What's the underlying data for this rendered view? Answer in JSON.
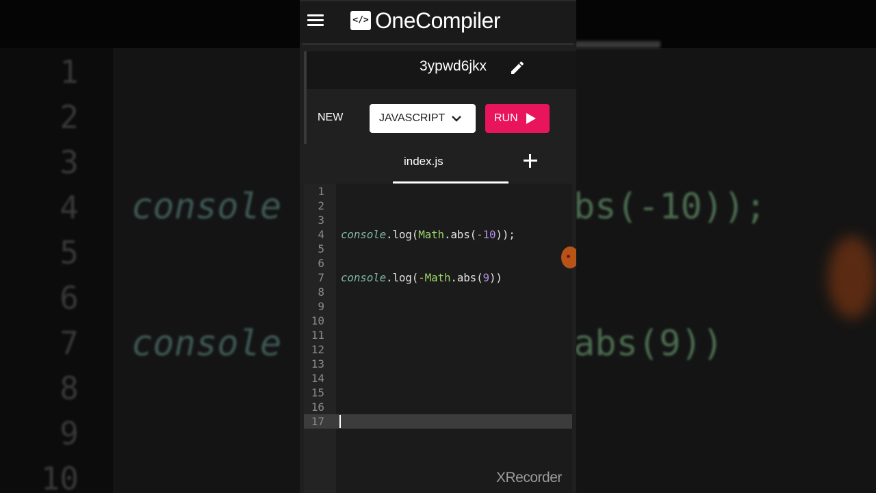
{
  "app": {
    "logo_mark": "</>",
    "name": "OneCompiler",
    "project_name": "3ypwd6jkx"
  },
  "toolbar": {
    "new_label": "NEW",
    "language": "JAVASCRIPT",
    "run_label": "RUN",
    "accent_color": "#e8155d"
  },
  "tabs": {
    "active_file": "index.js"
  },
  "editor": {
    "line_numbers": [
      "1",
      "2",
      "3",
      "4",
      "5",
      "6",
      "7",
      "8",
      "9",
      "10",
      "11",
      "12",
      "13",
      "14",
      "15",
      "16",
      "17"
    ],
    "active_line": "17",
    "lines": [
      {
        "number": 4,
        "tokens": [
          {
            "text": "console",
            "kind": "obj"
          },
          {
            "text": ".log(",
            "kind": "plain"
          },
          {
            "text": "Math",
            "kind": "cls"
          },
          {
            "text": ".abs(",
            "kind": "plain"
          },
          {
            "text": "-",
            "kind": "op"
          },
          {
            "text": "10",
            "kind": "num"
          },
          {
            "text": "));",
            "kind": "plain"
          }
        ]
      },
      {
        "number": 7,
        "tokens": [
          {
            "text": "console",
            "kind": "obj"
          },
          {
            "text": ".log(",
            "kind": "plain"
          },
          {
            "text": "-",
            "kind": "op"
          },
          {
            "text": "Math",
            "kind": "cls"
          },
          {
            "text": ".abs(",
            "kind": "plain"
          },
          {
            "text": "9",
            "kind": "num"
          },
          {
            "text": "))",
            "kind": "plain"
          }
        ]
      }
    ]
  },
  "background": {
    "line_numbers": [
      "1",
      "2",
      "3",
      "4",
      "5",
      "6",
      "7",
      "8",
      "9",
      "10"
    ],
    "code_fragments": [
      "console",
      "console",
      "bs(-10));",
      "abs(9))"
    ]
  },
  "watermark": "XRecorder"
}
